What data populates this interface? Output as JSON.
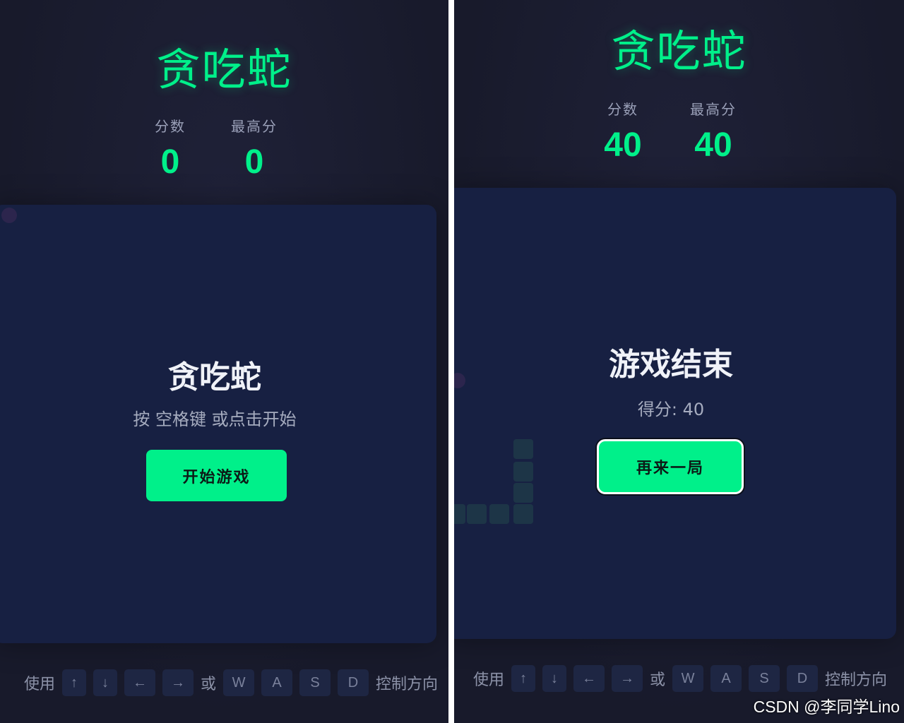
{
  "left": {
    "title": "贪吃蛇",
    "score_label": "分数",
    "score_value": "0",
    "best_label": "最高分",
    "best_value": "0",
    "overlay_title": "贪吃蛇",
    "overlay_hint": "按 空格键 或点击开始",
    "start_button": "开始游戏"
  },
  "right": {
    "title": "贪吃蛇",
    "score_label": "分数",
    "score_value": "40",
    "best_label": "最高分",
    "best_value": "40",
    "overlay_title": "游戏结束",
    "overlay_score": "得分: 40",
    "restart_button": "再来一局"
  },
  "controls": {
    "prefix": "使用",
    "keys_arrows": [
      "↑",
      "↓",
      "←",
      "→"
    ],
    "or": "或",
    "keys_wasd": [
      "W",
      "A",
      "S",
      "D"
    ],
    "suffix": "控制方向"
  },
  "watermark": "CSDN @李同学Lino",
  "colors": {
    "accent": "#00f08a",
    "background": "#181a2b",
    "board": "#172042",
    "key_bg": "#1e2643"
  }
}
